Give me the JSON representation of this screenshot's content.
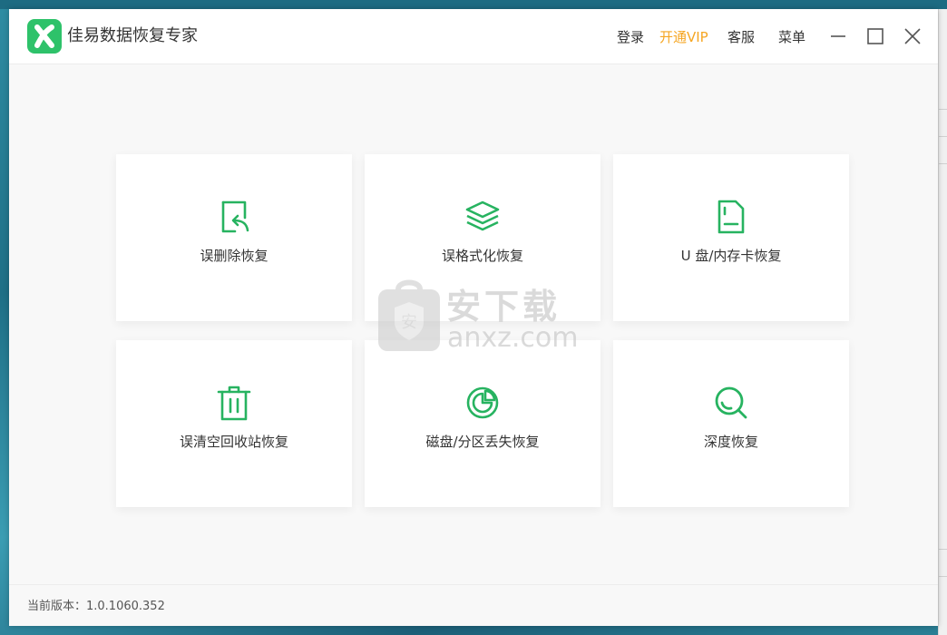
{
  "app": {
    "title": "佳易数据恢复专家",
    "brand_color": "#2ec26a",
    "vip_color": "#f5a623"
  },
  "titlebar": {
    "login_label": "登录",
    "vip_label": "开通VIP",
    "service_label": "客服",
    "menu_label": "菜单"
  },
  "cards": [
    {
      "label": "误删除恢复",
      "icon": "file-restore-icon"
    },
    {
      "label": "误格式化恢复",
      "icon": "layers-icon"
    },
    {
      "label": "U 盘/内存卡恢复",
      "icon": "sd-card-icon"
    },
    {
      "label": "误清空回收站恢复",
      "icon": "trash-icon"
    },
    {
      "label": "磁盘/分区丢失恢复",
      "icon": "pie-chart-icon"
    },
    {
      "label": "深度恢复",
      "icon": "magnifier-icon"
    }
  ],
  "watermark": {
    "text": "安下载",
    "sub": "anxz.com"
  },
  "footer": {
    "version": "当前版本：1.0.1060.352"
  }
}
